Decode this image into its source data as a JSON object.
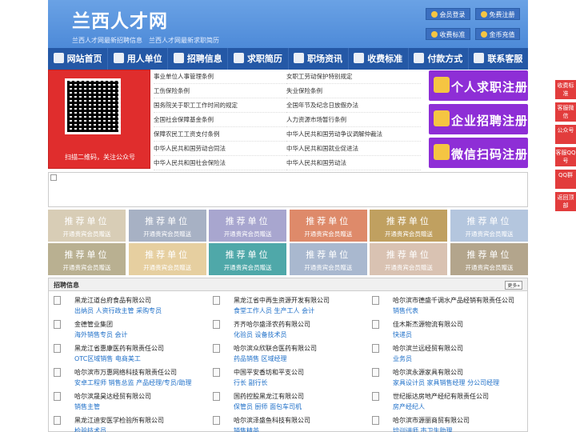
{
  "header": {
    "logo": "兰西人才网",
    "slogan": "兰西人才网最新招聘信息　兰西人才网最新求职简历",
    "buttons": [
      "会员登录",
      "免费注册",
      "收费标准",
      "金币充值"
    ]
  },
  "nav": [
    "网站首页",
    "用人单位",
    "招聘信息",
    "求职简历",
    "职场资讯",
    "收费标准",
    "付款方式",
    "联系客服"
  ],
  "qr": {
    "caption": "扫描二维码，关注公众号"
  },
  "laws": {
    "left": [
      "事业单位人事管理条例",
      "工伤保险条例",
      "国务院关于职工工作时间的规定",
      "全国社会保障基金条例",
      "保障农民工工资支付条例",
      "中华人民共和国劳动合同法",
      "中华人民共和国社会保险法"
    ],
    "right": [
      "女职工劳动保护特别规定",
      "失业保险条例",
      "全国年节及纪念日放假办法",
      "人力资源市场暂行条例",
      "中华人民共和国劳动争议调解仲裁法",
      "中华人民共和国就业促进法",
      "中华人民共和国劳动法"
    ]
  },
  "register": [
    "个人求职注册",
    "企业招聘注册",
    "微信扫码注册"
  ],
  "ads": {
    "title": "推荐单位",
    "sub": "开通贵宾会员赠送",
    "colors": [
      "#d8cdb6",
      "#a7b1c4",
      "#a8a6cf",
      "#de8a6a",
      "#c0a060",
      "#b4c6de",
      "#b9b091",
      "#e6cfa0",
      "#4fa8a9",
      "#a9b8cf",
      "#d9c2b2",
      "#b3a58c"
    ]
  },
  "jobs": {
    "title": "招聘信息",
    "more": "更多»",
    "items": [
      {
        "co": "黑龙江道台府食品有限公司",
        "pos": "出纳员 人资行政主管 采购专员"
      },
      {
        "co": "黑龙江省中再生资源开发有限公司",
        "pos": "食堂工作人员 生产工人 会计"
      },
      {
        "co": "哈尔滨市德盛千调水产品经销有限责任公司",
        "pos": "销售代表"
      },
      {
        "co": "金德管业集团",
        "pos": "海外销售专员 会计"
      },
      {
        "co": "齐齐哈尔盛泽农药有限公司",
        "pos": "化验员 设备技术员"
      },
      {
        "co": "佳木斯杰源物流有限公司",
        "pos": "快递员"
      },
      {
        "co": "黑龙江省惠康医药有限责任公司",
        "pos": "OTC区域销售 电商美工"
      },
      {
        "co": "哈尔滨众欣联合医药有限公司",
        "pos": "药品销售 区域经理"
      },
      {
        "co": "哈尔滨兰远经贸有限公司",
        "pos": "业务员"
      },
      {
        "co": "哈尔滨市万惠网络科技有限责任公司",
        "pos": "安卓工程师 销售总监 产品经理/专员/助理"
      },
      {
        "co": "中国平安香坊和平支公司",
        "pos": "行长 副行长"
      },
      {
        "co": "哈尔滨永源家具有限公司",
        "pos": "家具设计员 家具销售经理 分公司经理"
      },
      {
        "co": "哈尔滨晟昊达经贸有限公司",
        "pos": "销售主管"
      },
      {
        "co": "国药控股黑龙江有限公司",
        "pos": "保管员 厨师 面包车司机"
      },
      {
        "co": "世纪振达房地产经纪有限责任公司",
        "pos": "房产经纪人"
      },
      {
        "co": "黑龙江迪安医学检验所有限公司",
        "pos": "检验技术员"
      },
      {
        "co": "哈尔滨泽盛鱼科技有限公司",
        "pos": "销售精英"
      },
      {
        "co": "哈尔滨市源丽商贸有限公司",
        "pos": "培训讲师 市卫生助理"
      }
    ]
  },
  "side": [
    "收费标准",
    "客服微信",
    "公众号",
    "客服QQ号",
    "QQ群",
    "返回顶部"
  ],
  "colors": {
    "nav": "#2458a6",
    "reg": "#8e2ed6",
    "qr": "#e02d2d",
    "link": "#1e6fc8",
    "side": "#e23c3c"
  }
}
